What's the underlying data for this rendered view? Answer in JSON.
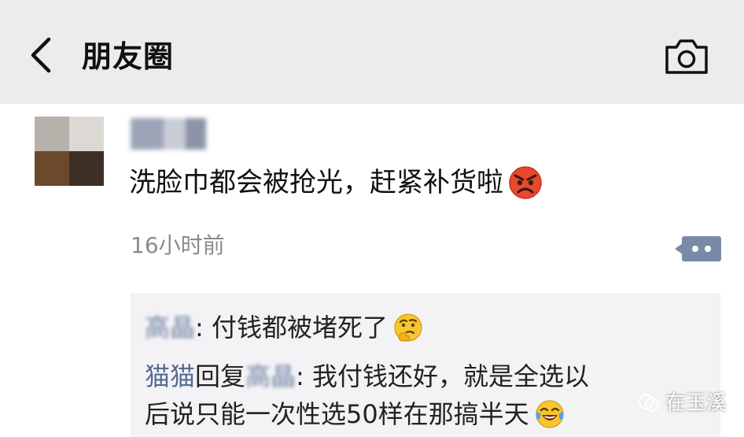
{
  "header": {
    "title": "朋友圈",
    "back_icon": "chevron-left-icon",
    "camera_icon": "camera-icon"
  },
  "post": {
    "author": "",
    "text": "洗脸巾都会被抢光，赶紧补货啦",
    "emoji": "angry-face-icon",
    "time": "16小时前",
    "more_icon": "more-dots-icon"
  },
  "comments": [
    {
      "name": "高晶",
      "text": ": 付钱都被堵死了",
      "emoji": "thinking-face-icon"
    },
    {
      "name": "猫猫",
      "reply_word": "回复",
      "reply_to": "高晶",
      "text_line1": ": 我付钱还好，就是全选以",
      "text_line2": "后说只能一次性选50样在那搞半天",
      "emoji": "tears-of-joy-icon"
    }
  ],
  "watermark": {
    "text": "在玉溪",
    "icon": "wechat-channel-icon"
  },
  "colors": {
    "header_bg": "#ececec",
    "link_blue": "#576b95",
    "comment_bg": "#f3f3f5",
    "more_button": "#7a8aa6"
  }
}
